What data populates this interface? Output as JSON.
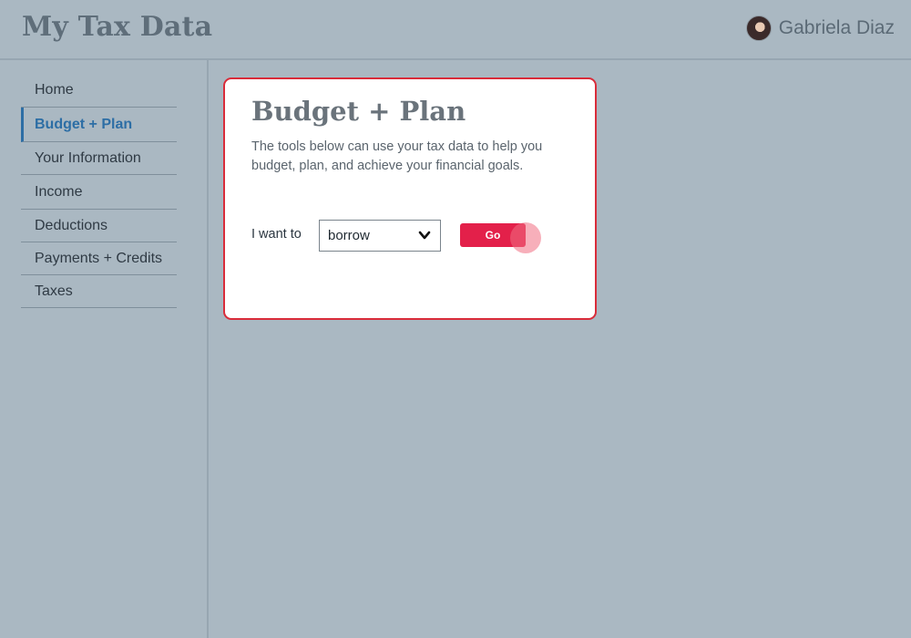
{
  "header": {
    "app_title": "My Tax Data",
    "user_name": "Gabriela Diaz"
  },
  "sidebar": {
    "items": [
      {
        "label": "Home",
        "active": false
      },
      {
        "label": "Budget + Plan",
        "active": true
      },
      {
        "label": "Your Information",
        "active": false
      },
      {
        "label": "Income",
        "active": false
      },
      {
        "label": "Deductions",
        "active": false
      },
      {
        "label": "Payments + Credits",
        "active": false
      },
      {
        "label": "Taxes",
        "active": false
      }
    ]
  },
  "card": {
    "title": "Budget + Plan",
    "description": "The tools below can use your tax data to help you budget, plan, and achieve your financial goals.",
    "want_label": "I want to",
    "select_value": "borrow",
    "go_label": "Go"
  },
  "colors": {
    "background": "#aab8c2",
    "accent_red": "#e3204a",
    "card_border": "#d92c3a",
    "active_nav": "#2d6ea5"
  },
  "icons": {
    "avatar": "user-avatar",
    "select_chevron": "chevron-down-icon"
  }
}
